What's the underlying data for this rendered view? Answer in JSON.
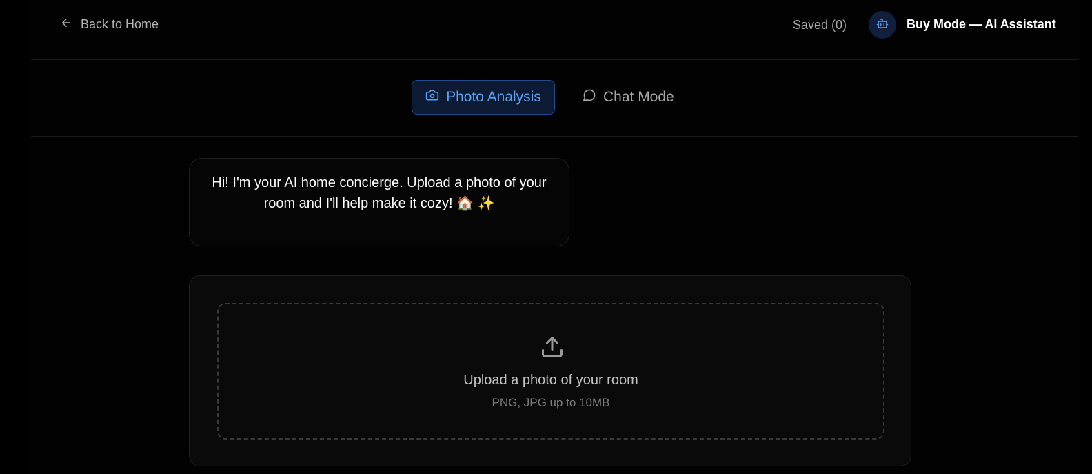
{
  "header": {
    "back_label": "Back to Home",
    "saved_label": "Saved (0)",
    "mode_title": "Buy Mode — AI Assistant"
  },
  "tabs": [
    {
      "label": "Photo Analysis",
      "icon": "camera-icon",
      "active": true
    },
    {
      "label": "Chat Mode",
      "icon": "chat-bubble-icon",
      "active": false
    }
  ],
  "chat": {
    "welcome_message": "Hi! I'm your AI home concierge. Upload a photo of your room and I'll help make it cozy! 🏠 ✨"
  },
  "upload": {
    "title": "Upload a photo of your room",
    "hint": "PNG, JPG up to 10MB",
    "icon": "upload-icon"
  },
  "colors": {
    "background": "#000000",
    "accent": "#5aa2f5",
    "accent_bg": "#0c1a33",
    "accent_border": "#1f4c8f"
  }
}
